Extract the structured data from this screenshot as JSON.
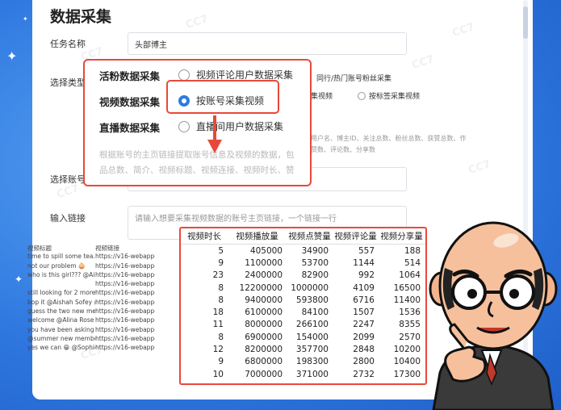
{
  "page": {
    "title": "数据采集",
    "task_name_label": "任务名称",
    "task_name_value": "头部博主",
    "select_type_label": "选择类型",
    "select_account_label": "选择账号",
    "input_link_label": "输入链接",
    "input_link_placeholder": "请输入想要采集视频数据的账号主页链接，一个链接一行"
  },
  "background_options": {
    "opt1": "同行/热门账号粉丝采集",
    "opt2": "采集视频",
    "opt3": "按标签采集视频",
    "faint1": "用户名、博主ID、关注总数、粉丝总数、获赞总数、作",
    "faint2": "赞数、评论数、分享数"
  },
  "popup": {
    "rows": [
      {
        "label": "活粉数据采集",
        "option": "视频评论用户数据采集",
        "selected": false
      },
      {
        "label": "视频数据采集",
        "option": "按账号采集视频",
        "selected": true
      },
      {
        "label": "直播数据采集",
        "option": "直播间用户数据采集",
        "selected": false
      }
    ],
    "desc_line1": "根据账号的主页链接提取账号信息及视频的数据，包",
    "desc_line2": "品总数、简介、视频标题、视频连接、视频时长、赞"
  },
  "bg_table": {
    "headers": [
      "视频标题",
      "视频链接"
    ],
    "rows": [
      [
        "time to spill some tea...",
        "https://v16-webapp-"
      ],
      [
        "not our problem 🧅",
        "https://v16-webapp-"
      ],
      [
        "who is this girl??? @Aish",
        "https://v16-webapp-"
      ],
      [
        "",
        "https://v16-webapp-"
      ],
      [
        "still looking for 2 more ♦",
        "https://v16-webapp-"
      ],
      [
        "bop it @Aishah Sofey @",
        "https://v16-webapp-"
      ],
      [
        "guess the two new mem",
        "https://v16-webapp-"
      ],
      [
        "welcome @Alina Rose !!",
        "https://v16-webapp-"
      ],
      [
        "you have been asking so",
        "https://v16-webapp-"
      ],
      [
        "@summer new member",
        "https://v16-webapp-"
      ],
      [
        "yes we can 😁 @Sophie",
        "https://v16-webapp-"
      ]
    ]
  },
  "stats_table": {
    "headers": [
      "视频时长",
      "视频播放量",
      "视频点赞量",
      "视频评论量",
      "视频分享量"
    ],
    "rows": [
      [
        "5",
        "405000",
        "34900",
        "557",
        "188"
      ],
      [
        "9",
        "1100000",
        "53700",
        "1144",
        "514"
      ],
      [
        "23",
        "2400000",
        "82900",
        "992",
        "1064"
      ],
      [
        "8",
        "12200000",
        "1000000",
        "4109",
        "16500"
      ],
      [
        "8",
        "9400000",
        "593800",
        "6716",
        "11400"
      ],
      [
        "18",
        "6100000",
        "84100",
        "1507",
        "1536"
      ],
      [
        "11",
        "8000000",
        "266100",
        "2247",
        "8355"
      ],
      [
        "8",
        "6900000",
        "154000",
        "2099",
        "2570"
      ],
      [
        "12",
        "8200000",
        "357700",
        "2848",
        "10200"
      ],
      [
        "9",
        "6800000",
        "198300",
        "2800",
        "10400"
      ],
      [
        "10",
        "7000000",
        "371000",
        "2732",
        "17300"
      ]
    ]
  },
  "colors": {
    "accent": "#2a7de1",
    "highlight": "#e8493a",
    "background": "#2f78e0"
  }
}
